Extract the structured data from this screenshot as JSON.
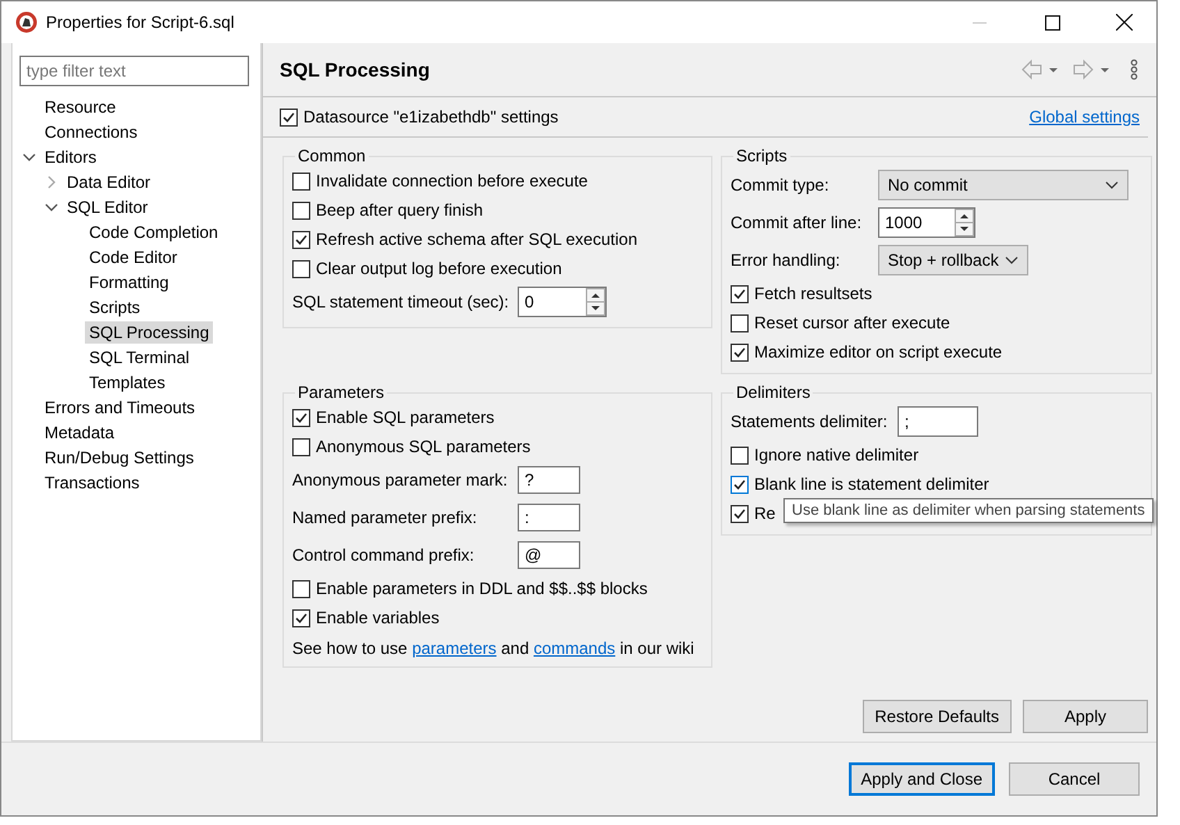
{
  "window": {
    "title": "Properties for Script-6.sql"
  },
  "sidebar": {
    "filter": {
      "placeholder": "type filter text"
    },
    "items": [
      {
        "label": "Resource",
        "selected": false
      },
      {
        "label": "Connections",
        "selected": false
      },
      {
        "label": "Editors",
        "selected": false,
        "expanded": true,
        "children": [
          {
            "label": "Data Editor",
            "selected": false,
            "expanded": false
          },
          {
            "label": "SQL Editor",
            "selected": false,
            "expanded": true,
            "children": [
              {
                "label": "Code Completion",
                "selected": false
              },
              {
                "label": "Code Editor",
                "selected": false
              },
              {
                "label": "Formatting",
                "selected": false
              },
              {
                "label": "Scripts",
                "selected": false
              },
              {
                "label": "SQL Processing",
                "selected": true
              },
              {
                "label": "SQL Terminal",
                "selected": false
              },
              {
                "label": "Templates",
                "selected": false
              }
            ]
          }
        ]
      },
      {
        "label": "Errors and Timeouts",
        "selected": false
      },
      {
        "label": "Metadata",
        "selected": false
      },
      {
        "label": "Run/Debug Settings",
        "selected": false
      },
      {
        "label": "Transactions",
        "selected": false
      }
    ]
  },
  "page": {
    "title": "SQL Processing",
    "datasource": {
      "label": "Datasource \"e1izabethdb\" settings",
      "checked": true
    },
    "global_settings": "Global settings"
  },
  "common": {
    "title": "Common",
    "options": [
      {
        "label": "Invalidate connection before execute",
        "checked": false
      },
      {
        "label": "Beep after query finish",
        "checked": false
      },
      {
        "label": "Refresh active schema after SQL execution",
        "checked": true
      },
      {
        "label": "Clear output log before execution",
        "checked": false
      }
    ],
    "timeout": {
      "label": "SQL statement timeout (sec):",
      "value": "0"
    }
  },
  "scripts": {
    "title": "Scripts",
    "commit_type": {
      "label": "Commit type:",
      "value": "No commit"
    },
    "commit_after_line": {
      "label": "Commit after line:",
      "value": "1000"
    },
    "error_handling": {
      "label": "Error handling:",
      "value": "Stop + rollback"
    },
    "options": [
      {
        "label": "Fetch resultsets",
        "checked": true
      },
      {
        "label": "Reset cursor after execute",
        "checked": false
      },
      {
        "label": "Maximize editor on script execute",
        "checked": true
      }
    ]
  },
  "parameters": {
    "title": "Parameters",
    "options": [
      {
        "label": "Enable SQL parameters",
        "checked": true
      },
      {
        "label": "Anonymous SQL parameters",
        "checked": false
      }
    ],
    "fields": [
      {
        "label": "Anonymous parameter mark:",
        "value": "?"
      },
      {
        "label": "Named parameter prefix:",
        "value": ":"
      },
      {
        "label": "Control command prefix:",
        "value": "@"
      }
    ],
    "more_options": [
      {
        "label": "Enable parameters in DDL and $$..$$ blocks",
        "checked": false
      },
      {
        "label": "Enable variables",
        "checked": true
      }
    ],
    "wiki": [
      {
        "kind": "text",
        "text": "See how to use "
      },
      {
        "kind": "link",
        "text": "parameters"
      },
      {
        "kind": "text",
        "text": " and "
      },
      {
        "kind": "link",
        "text": "commands"
      },
      {
        "kind": "text",
        "text": " in our wiki"
      }
    ]
  },
  "delimiters": {
    "title": "Delimiters",
    "statements_delimiter": {
      "label": "Statements delimiter:",
      "value": ";"
    },
    "options": [
      {
        "label": "Ignore native delimiter",
        "checked": false
      },
      {
        "label": "Blank line is statement delimiter",
        "checked": true,
        "hovered": true
      },
      {
        "label": "Re",
        "checked": true
      }
    ]
  },
  "tooltip": "Use blank line as delimiter when parsing statements",
  "buttons": {
    "restore_defaults": "Restore Defaults",
    "apply": "Apply",
    "apply_and_close": "Apply and Close",
    "cancel": "Cancel"
  }
}
